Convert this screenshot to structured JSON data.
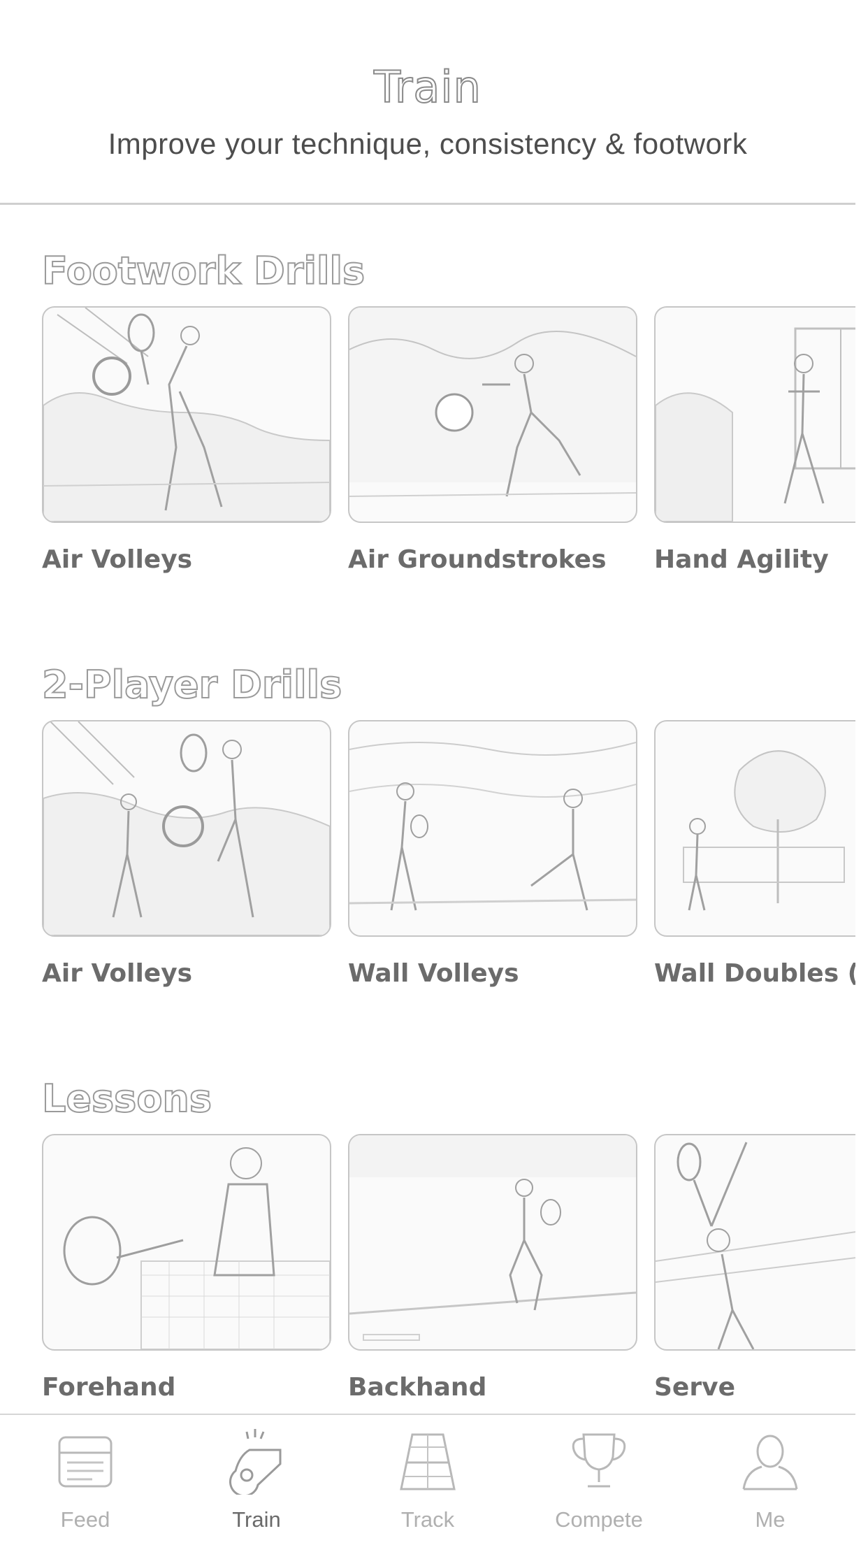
{
  "header": {
    "title": "Train",
    "subtitle": "Improve your technique, consistency & footwork"
  },
  "sections": [
    {
      "title": "Footwork Drills",
      "cards": [
        {
          "label": "Air Volleys"
        },
        {
          "label": "Air Groundstrokes"
        },
        {
          "label": "Hand Agility"
        }
      ]
    },
    {
      "title": "2-Player Drills",
      "cards": [
        {
          "label": "Air Volleys"
        },
        {
          "label": "Wall Volleys"
        },
        {
          "label": "Wall Doubles (D"
        }
      ]
    },
    {
      "title": "Lessons",
      "cards": [
        {
          "label": "Forehand"
        },
        {
          "label": "Backhand"
        },
        {
          "label": "Serve"
        }
      ]
    }
  ],
  "tabbar": {
    "active": "Train",
    "tabs": [
      {
        "label": "Feed",
        "icon": "feed-icon"
      },
      {
        "label": "Train",
        "icon": "whistle-icon"
      },
      {
        "label": "Track",
        "icon": "tennis-court-icon"
      },
      {
        "label": "Compete",
        "icon": "trophy-icon"
      },
      {
        "label": "Me",
        "icon": "person-icon"
      }
    ]
  }
}
